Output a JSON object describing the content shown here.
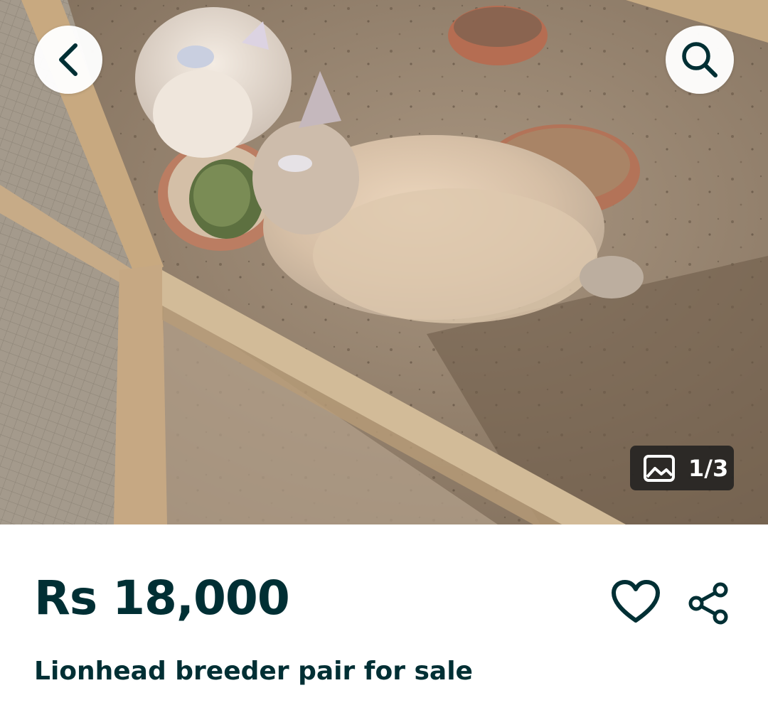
{
  "gallery": {
    "image_alt": "Two lionhead rabbits eating from clay bowls inside a wooden enclosure",
    "counter_text": "1/3"
  },
  "header": {
    "back_icon": "chevron-left-icon",
    "search_icon": "search-icon"
  },
  "listing": {
    "price": "Rs 18,000",
    "title": "Lionhead breeder pair for sale",
    "favorite_icon": "heart-icon",
    "share_icon": "share-icon"
  },
  "colors": {
    "primary_text": "#002f34",
    "counter_bg": "#1e1e1e",
    "button_bg": "#ffffff"
  }
}
